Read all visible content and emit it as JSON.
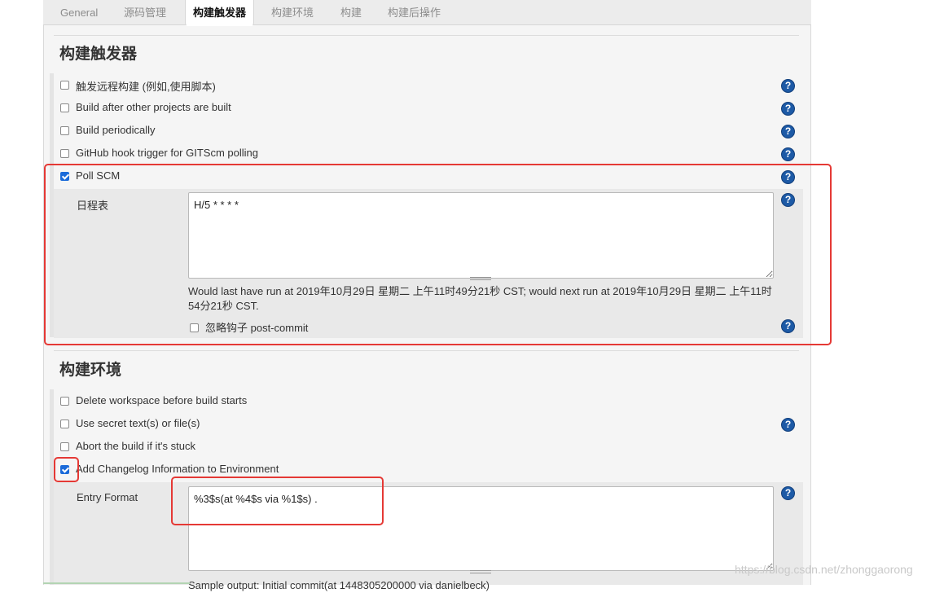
{
  "tabs": [
    "General",
    "源码管理",
    "构建触发器",
    "构建环境",
    "构建",
    "构建后操作"
  ],
  "triggers": {
    "title": "构建触发器",
    "items": [
      {
        "label": "触发远程构建 (例如,使用脚本)",
        "checked": false
      },
      {
        "label": "Build after other projects are built",
        "checked": false
      },
      {
        "label": "Build periodically",
        "checked": false
      },
      {
        "label": "GitHub hook trigger for GITScm polling",
        "checked": false
      },
      {
        "label": "Poll SCM",
        "checked": true
      }
    ],
    "schedule_label": "日程表",
    "schedule_value": "H/5 * * * *",
    "schedule_info": "Would last have run at 2019年10月29日 星期二 上午11时49分21秒 CST; would next run at 2019年10月29日 星期二 上午11时54分21秒 CST.",
    "ignore_hooks_label": "忽略钩子 post-commit",
    "ignore_hooks_checked": false
  },
  "build_env": {
    "title": "构建环境",
    "items": [
      {
        "label": "Delete workspace before build starts",
        "checked": false
      },
      {
        "label": "Use secret text(s) or file(s)",
        "checked": false
      },
      {
        "label": "Abort the build if it's stuck",
        "checked": false
      },
      {
        "label": "Add Changelog Information to Environment",
        "checked": true
      }
    ],
    "entry_format_label": "Entry Format",
    "entry_format_value": "%3$s(at %4$s via %1$s) .",
    "sample_output": "Sample output: Initial commit(at 1448305200000 via danielbeck)"
  },
  "help_glyph": "?",
  "watermark": "https://blog.csdn.net/zhonggaorong",
  "colors": {
    "accent": "#1a6ad9",
    "help": "#1d5aa6",
    "highlight": "#e53935"
  }
}
